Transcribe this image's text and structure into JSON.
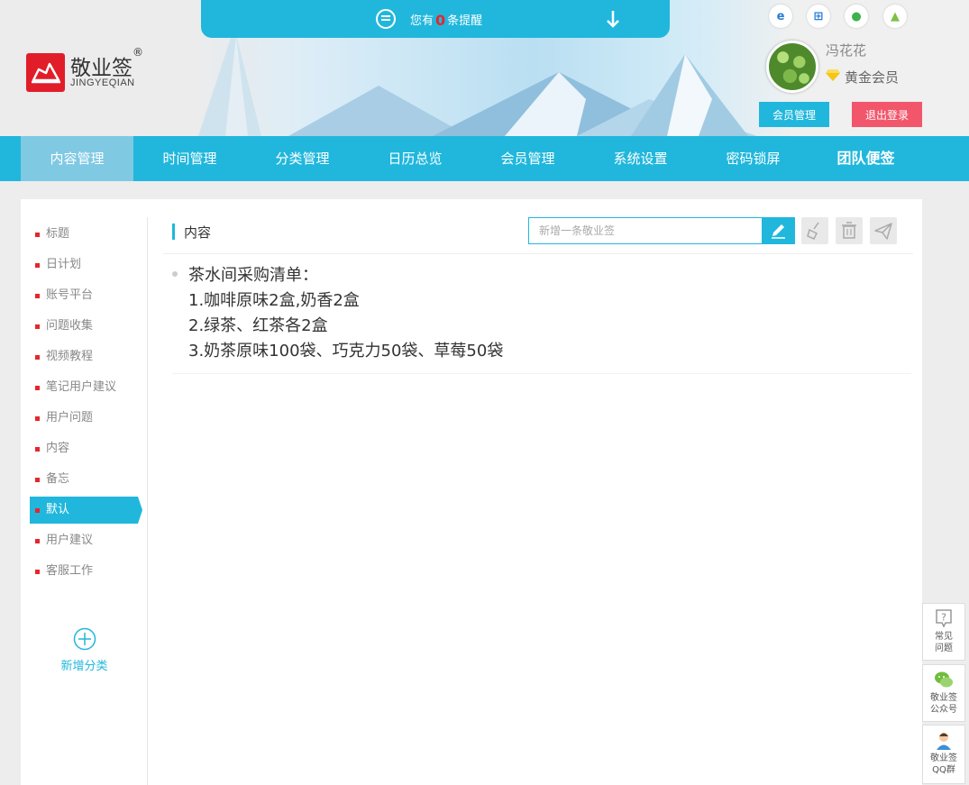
{
  "notice": {
    "prefix": "您有",
    "count": "0",
    "suffix": "条提醒"
  },
  "logo": {
    "name": "敬业签",
    "reg": "®",
    "pinyin": "JINGYEQIAN"
  },
  "user": {
    "name": "冯花花",
    "level": "黄金会员"
  },
  "header_buttons": {
    "member": "会员管理",
    "logout": "退出登录"
  },
  "nav": [
    "内容管理",
    "时间管理",
    "分类管理",
    "日历总览",
    "会员管理",
    "系统设置",
    "密码锁屏",
    "团队便签"
  ],
  "categories": [
    "标题",
    "日计划",
    "账号平台",
    "问题收集",
    "视频教程",
    "笔记用户建议",
    "用户问题",
    "内容",
    "备忘",
    "默认",
    "用户建议",
    "客服工作"
  ],
  "active_category": "默认",
  "add_category": "新增分类",
  "main": {
    "title": "内容",
    "search_placeholder": "新增一条敬业签",
    "note_lines": [
      "茶水间采购清单：",
      "1.咖啡原味2盒,奶香2盒",
      "2.绿茶、红茶各2盒",
      "3.奶茶原味100袋、巧克力50袋、草莓50袋"
    ]
  },
  "float_panel": {
    "faq": [
      "常见",
      "问题"
    ],
    "wechat": [
      "敬业签",
      "公众号"
    ],
    "qq": [
      "敬业签",
      "QQ群"
    ]
  },
  "colors": {
    "accent": "#21b7dc",
    "danger": "#f2566b",
    "logo_red": "#e21d2a"
  }
}
